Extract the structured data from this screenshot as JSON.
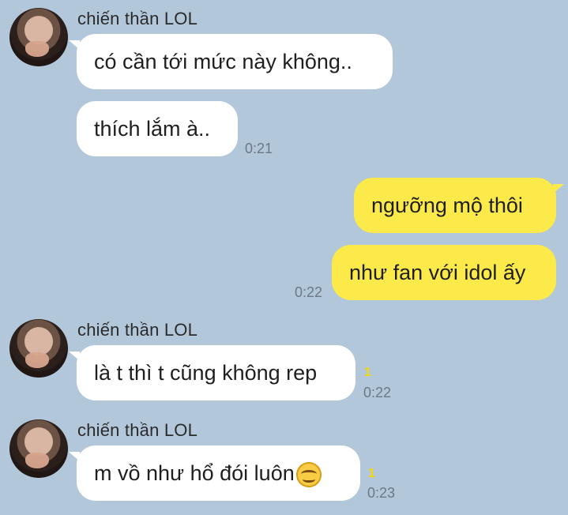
{
  "messages": [
    {
      "sender": "chiến thần LOL",
      "text": "có cần tới mức này không.."
    },
    {
      "text": "thích lắm à..",
      "time": "0:21"
    },
    {
      "text": "ngưỡng mộ thôi"
    },
    {
      "text": "như fan với idol ấy",
      "time": "0:22"
    },
    {
      "sender": "chiến thần LOL",
      "text": "là t thì t cũng không rep",
      "unread": "1",
      "time": "0:22"
    },
    {
      "sender": "chiến thần LOL",
      "text": "m vồ như hổ đói luôn",
      "emoji": "smiling-face-icon",
      "unread": "1",
      "time": "0:23"
    }
  ],
  "colors": {
    "background": "#b2c7d9",
    "incoming_bubble": "#ffffff",
    "outgoing_bubble": "#fce94a",
    "unread": "#f5d800"
  }
}
